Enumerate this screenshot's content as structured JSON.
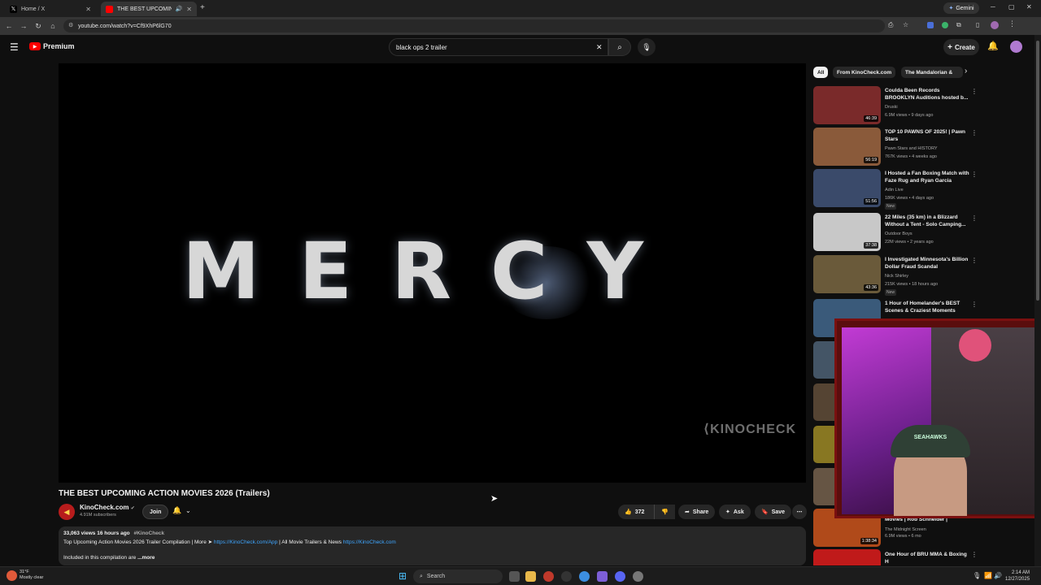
{
  "browser": {
    "tabs": [
      {
        "label": "Home / X",
        "favicon_color": "#000000"
      },
      {
        "label": "THE BEST UPCOMING ACTI",
        "favicon_color": "#ff0000"
      }
    ],
    "url": "youtube.com/watch?v=Cf9XhP6lG70",
    "gemini_label": "Gemini"
  },
  "youtube": {
    "logo_label": "Premium",
    "search_value": "black ops 2 trailer",
    "create_label": "Create",
    "video": {
      "screen_title": "MERCY",
      "watermark": "KINOCHECK",
      "title": "THE BEST UPCOMING ACTION MOVIES 2026 (Trailers)",
      "channel": "KinoCheck.com",
      "subscribers": "4.91M subscribers",
      "join_label": "Join",
      "likes": "372",
      "share_label": "Share",
      "ask_label": "Ask",
      "save_label": "Save",
      "description": {
        "stats": "33,063 views  16 hours ago",
        "hashtag": "#KinoCheck",
        "line2_text1": "Top Upcoming Action Movies 2026 Trailer Compilation | More ➤ ",
        "line2_link1": "https://KinoCheck.com/App",
        "line2_text2": " | All Movie Trailers & News ",
        "line2_link2": "https://KinoCheck.com",
        "line3": "Included in this compilation are",
        "more_label": "...more"
      }
    },
    "chips": [
      "All",
      "From KinoCheck.com",
      "The Mandalorian &"
    ],
    "recommendations": [
      {
        "title": "Coulda Been Records BROOKLYN Auditions hosted b...",
        "channel": "Druski",
        "meta": "6.9M views • 9 days ago",
        "duration": "46:39",
        "thumb_color": "#7a2a2a"
      },
      {
        "title": "TOP 10 PAWNS OF 2025! | Pawn Stars",
        "channel": "Pawn Stars  and HISTORY",
        "meta": "767K views • 4 weeks ago",
        "duration": "56:19",
        "thumb_color": "#8a5a3a"
      },
      {
        "title": "I Hosted a Fan Boxing Match with Faze Rug and Ryan Garcia",
        "channel": "Adin Live",
        "meta": "186K views • 4 days ago",
        "duration": "51:56",
        "badge": "New",
        "thumb_color": "#3a4a6a"
      },
      {
        "title": "22 Miles (35 km) in a Blizzard Without a Tent - Solo Camping...",
        "channel": "Outdoor Boys",
        "meta": "22M views • 2 years ago",
        "duration": "37:38",
        "thumb_color": "#c8c8c8"
      },
      {
        "title": "I Investigated Minnesota's Billion Dollar Fraud Scandal",
        "channel": "Nick Shirley",
        "meta": "215K views • 18 hours ago",
        "duration": "43:36",
        "badge": "New",
        "thumb_color": "#6a5a3a"
      },
      {
        "title": "1 Hour of Homelander's BEST Scenes & Craziest Moments",
        "channel": "",
        "meta": "",
        "duration": "",
        "thumb_color": "#3a5a7a"
      }
    ],
    "bottom_recs": [
      {
        "title": "Movies | Rob Schneider |",
        "channel": "The Midnight Screen",
        "meta": "6.9M views • 6 mo",
        "duration": "1:38:34",
        "thumb_color": "#b04a1a"
      },
      {
        "title": "One Hour of BRU MMA & Boxing H",
        "channel": "",
        "meta": "",
        "duration": "",
        "thumb_color": "#c01a1a"
      }
    ],
    "partial_thumb_colors": [
      "#445566",
      "#554433",
      "#887722",
      "#665544"
    ]
  },
  "webcam": {
    "hat_text": "SEAHAWKS"
  },
  "taskbar": {
    "weather_temp": "31°F",
    "weather_desc": "Mostly clear",
    "search_label": "Search",
    "time": "2:14 AM",
    "date": "12/27/2025"
  }
}
